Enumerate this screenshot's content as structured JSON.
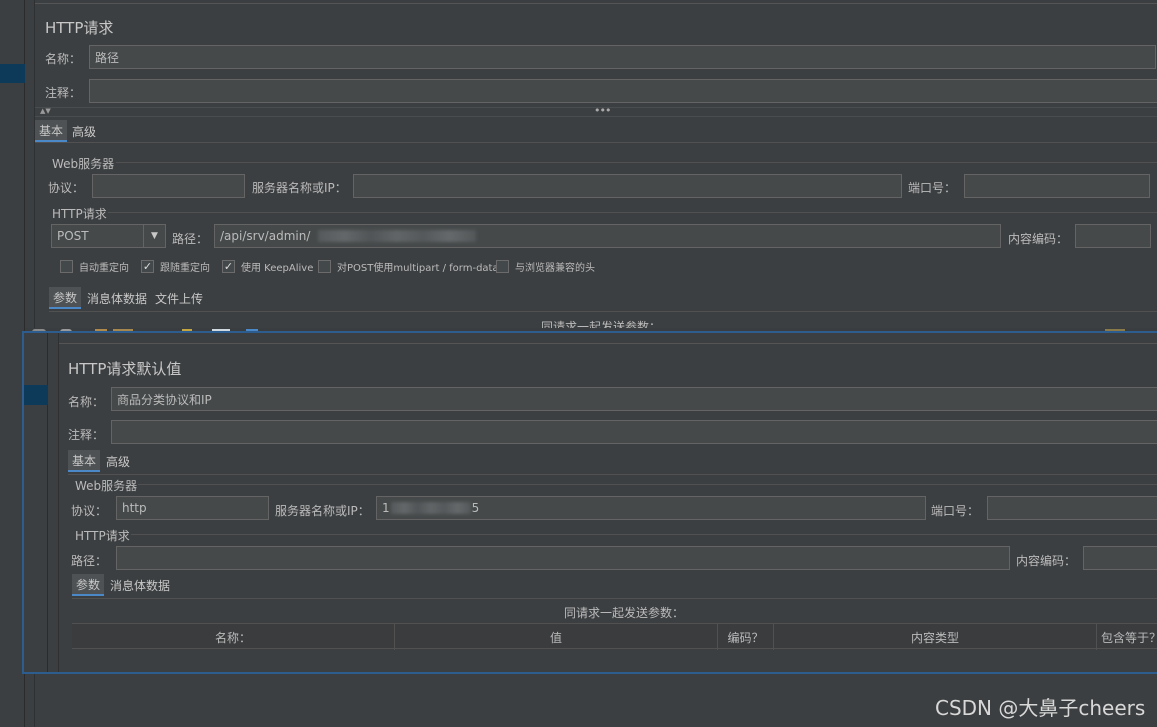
{
  "top_panel": {
    "title": "HTTP请求",
    "name_label": "名称：",
    "name_value": "路径",
    "comment_label": "注释：",
    "comment_value": "",
    "tabs": [
      "基本",
      "高级"
    ],
    "web_server_group": "Web服务器",
    "protocol_label": "协议：",
    "protocol_value": "",
    "server_label": "服务器名称或IP：",
    "server_value": "",
    "port_label": "端口号：",
    "port_value": "",
    "http_request_group": "HTTP请求",
    "method_value": "POST",
    "path_label": "路径：",
    "path_value": "/api/srv/admin/",
    "encoding_label": "内容编码：",
    "encoding_value": "",
    "checkboxes": [
      {
        "label": "自动重定向",
        "checked": false
      },
      {
        "label": "跟随重定向",
        "checked": true
      },
      {
        "label": "使用 KeepAlive",
        "checked": true
      },
      {
        "label": "对POST使用multipart / form-data",
        "checked": false
      },
      {
        "label": "与浏览器兼容的头",
        "checked": false
      }
    ],
    "sub_tabs": [
      "参数",
      "消息体数据",
      "文件上传"
    ],
    "params_caption": "同请求一起发送参数："
  },
  "bottom_panel": {
    "title": "HTTP请求默认值",
    "name_label": "名称：",
    "name_value": "商品分类协议和IP",
    "comment_label": "注释：",
    "comment_value": "",
    "tabs": [
      "基本",
      "高级"
    ],
    "web_server_group": "Web服务器",
    "protocol_label": "协议：",
    "protocol_value": "http",
    "server_label": "服务器名称或IP：",
    "server_value_prefix": "1",
    "server_value_suffix": "5",
    "port_label": "端口号：",
    "port_value": "",
    "http_request_group": "HTTP请求",
    "path_label": "路径：",
    "path_value": "",
    "encoding_label": "内容编码：",
    "encoding_value": "",
    "sub_tabs": [
      "参数",
      "消息体数据"
    ],
    "params_caption": "同请求一起发送参数：",
    "table_headers": [
      "名称：",
      "值",
      "编码？",
      "内容类型",
      "包含等于？"
    ]
  },
  "watermark": "CSDN @大鼻子cheers",
  "colors": {
    "background": "#3c3f41",
    "field": "#45494a",
    "accent": "#4a88c7",
    "selection": "#0d3a58"
  }
}
